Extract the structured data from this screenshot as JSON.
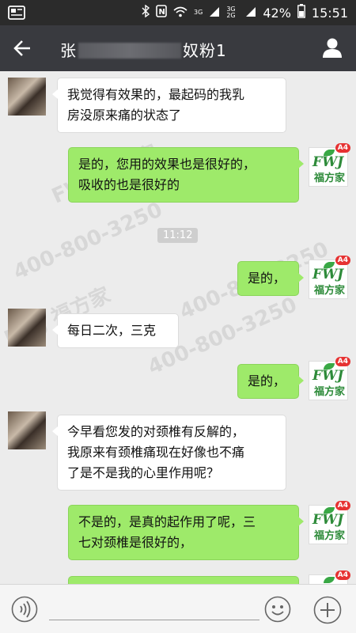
{
  "status_bar": {
    "network_a": "3G",
    "network_b": "3G 2G",
    "battery": "42%",
    "time": "15:51"
  },
  "header": {
    "title_prefix": "张",
    "title_suffix": "奴粉1"
  },
  "messages": [
    {
      "side": "left",
      "text": "我觉得有效果的，最起码的我乳\n房没原来痛的状态了"
    },
    {
      "side": "right",
      "text": "是的，您用的效果也是很好的，\n吸收的也是很好的"
    },
    {
      "side": "right",
      "text": "是的，"
    },
    {
      "side": "left",
      "text": "每日二次，三克"
    },
    {
      "side": "right",
      "text": "是的，"
    },
    {
      "side": "left",
      "text": "今早看您发的对颈椎有反解的，\n我原来有颈椎痛现在好像也不痛\n了是不是我的心里作用呢？"
    },
    {
      "side": "right",
      "text": "不是的，是真的起作用了呢，三\n七对颈椎是很好的，"
    }
  ],
  "timestamp": "11:12",
  "brand_avatar": {
    "logo": "FWJ",
    "chinese": "福方家",
    "badge": "A4"
  },
  "watermark": {
    "brand": "福方家",
    "phone": "400-800-3250",
    "domain": "FWJ"
  },
  "colors": {
    "sent_bubble": "#9eea6a",
    "received_bubble": "#ffffff",
    "titlebar": "#393a3f",
    "background": "#ececec"
  }
}
